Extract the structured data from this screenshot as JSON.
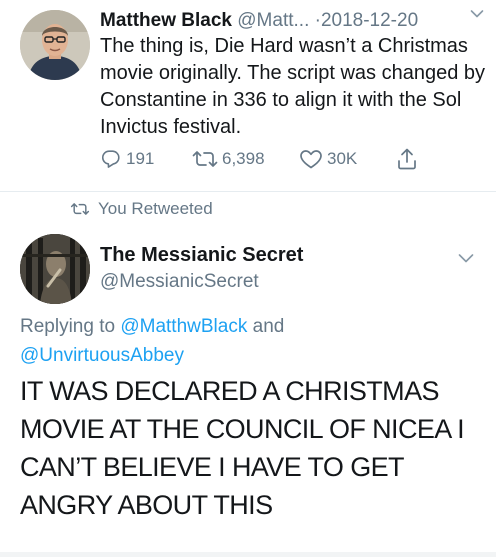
{
  "tweet1": {
    "author_name": "Matthew Black",
    "author_handle": "@Matt...",
    "dot": "·",
    "date": "2018-12-20",
    "text": "The thing is, Die Hard wasn’t a Christmas movie originally. The script was changed by Constantine in 336 to align it with the Sol Invictus festival.",
    "actions": {
      "reply_count": "191",
      "retweet_count": "6,398",
      "like_count": "30K"
    },
    "icons": [
      "reply-icon",
      "retweet-icon",
      "like-icon",
      "share-icon",
      "chevron-down-icon"
    ]
  },
  "retweet_context": {
    "label": "You Retweeted"
  },
  "tweet2": {
    "author_name": "The Messianic Secret",
    "author_handle": "@MessianicSecret",
    "replying_prefix": "Replying to ",
    "replying_user1": "@MatthwBlack",
    "replying_and": " and",
    "replying_user2": "@UnvirtuousAbbey",
    "text": "IT WAS DECLARED A CHRISTMAS MOVIE AT THE COUNCIL OF NICEA I CAN’T BELIEVE I HAVE TO GET ANGRY ABOUT THIS"
  },
  "colors": {
    "text": "#14171a",
    "secondary": "#657786",
    "link": "#1da1f2",
    "divider": "#e6ecf0"
  }
}
